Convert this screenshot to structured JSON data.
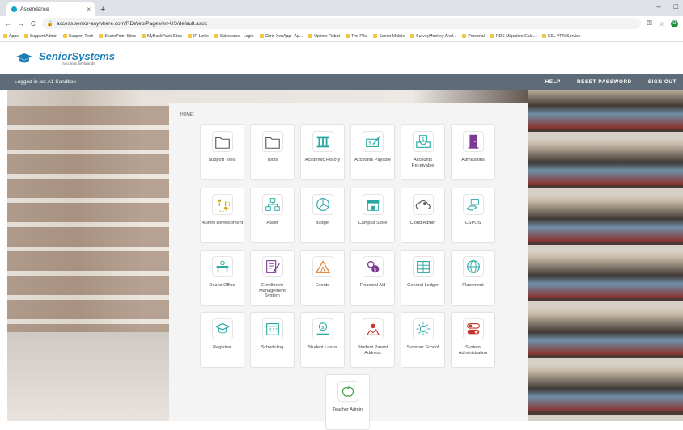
{
  "browser": {
    "tab_title": "Ascendance",
    "tab_close": "×",
    "new_tab": "+",
    "url": "access.senior-anywhere.com/RDWeb/Pages/en-US/default.aspx",
    "nav": {
      "back": "←",
      "forward": "→",
      "reload": "C"
    },
    "window_controls": {
      "minimize": "–",
      "maximize": "□"
    },
    "bookmarks": [
      "Apps",
      "Support Admin",
      "Support Tech",
      "SharePoint Sites",
      "MyBackPack Sites",
      "IR Links",
      "Salesforce - Login",
      "Citrix XenApp - Ap...",
      "Uptime Robot",
      "The Pike",
      "Senior Mobile",
      "SurveyMonkey Anal...",
      "Personal",
      "RDS Migration Cale...",
      "SSL VPN Service"
    ]
  },
  "brand": {
    "name": "SeniorSystems",
    "tagline": "by communitybrands"
  },
  "userbar": {
    "logged_in": "Logged in as: A1 Sandbox",
    "help": "HELP",
    "reset_password": "RESET PASSWORD",
    "sign_out": "SIGN OUT"
  },
  "breadcrumb": "HOME/",
  "colors": {
    "teal": "#27a7a1",
    "purple": "#7c3a93",
    "gold": "#d4a527",
    "red": "#c8342c",
    "orange": "#e07a2a",
    "darkgray": "#555555"
  },
  "apps": [
    {
      "label": "Support Tools",
      "icon": "folder-icon"
    },
    {
      "label": "Tools",
      "icon": "folder-icon"
    },
    {
      "label": "Academic History",
      "icon": "pillar-icon"
    },
    {
      "label": "Accounts Payable",
      "icon": "check-pen-icon"
    },
    {
      "label": "Accounts Receivable",
      "icon": "tray-dollar-icon"
    },
    {
      "label": "Admissions",
      "icon": "door-icon"
    },
    {
      "label": "Alumni Development",
      "icon": "alumni-icon"
    },
    {
      "label": "Asset",
      "icon": "asset-icon"
    },
    {
      "label": "Budget",
      "icon": "pie-chart-icon"
    },
    {
      "label": "Campus Store",
      "icon": "store-icon"
    },
    {
      "label": "Cloud Admin",
      "icon": "cloud-user-icon"
    },
    {
      "label": "CSPOS",
      "icon": "hand-card-icon"
    },
    {
      "label": "Deans Office",
      "icon": "desk-icon"
    },
    {
      "label": "Enrollment Management System",
      "icon": "form-pen-icon"
    },
    {
      "label": "Events",
      "icon": "tent-icon"
    },
    {
      "label": "Financial Aid",
      "icon": "gears-dollar-icon"
    },
    {
      "label": "General Ledger",
      "icon": "ledger-icon"
    },
    {
      "label": "Placement",
      "icon": "globe-icon"
    },
    {
      "label": "Registrar",
      "icon": "graduation-cap-icon"
    },
    {
      "label": "Scheduling",
      "icon": "calendar-icon"
    },
    {
      "label": "Student Loans",
      "icon": "coin-hand-icon"
    },
    {
      "label": "Student Parent Address",
      "icon": "map-pin-icon"
    },
    {
      "label": "Summer School",
      "icon": "sun-icon"
    },
    {
      "label": "System Administration",
      "icon": "toggle-icon"
    },
    {
      "label": "Teacher Admin",
      "icon": "apple-icon"
    }
  ]
}
